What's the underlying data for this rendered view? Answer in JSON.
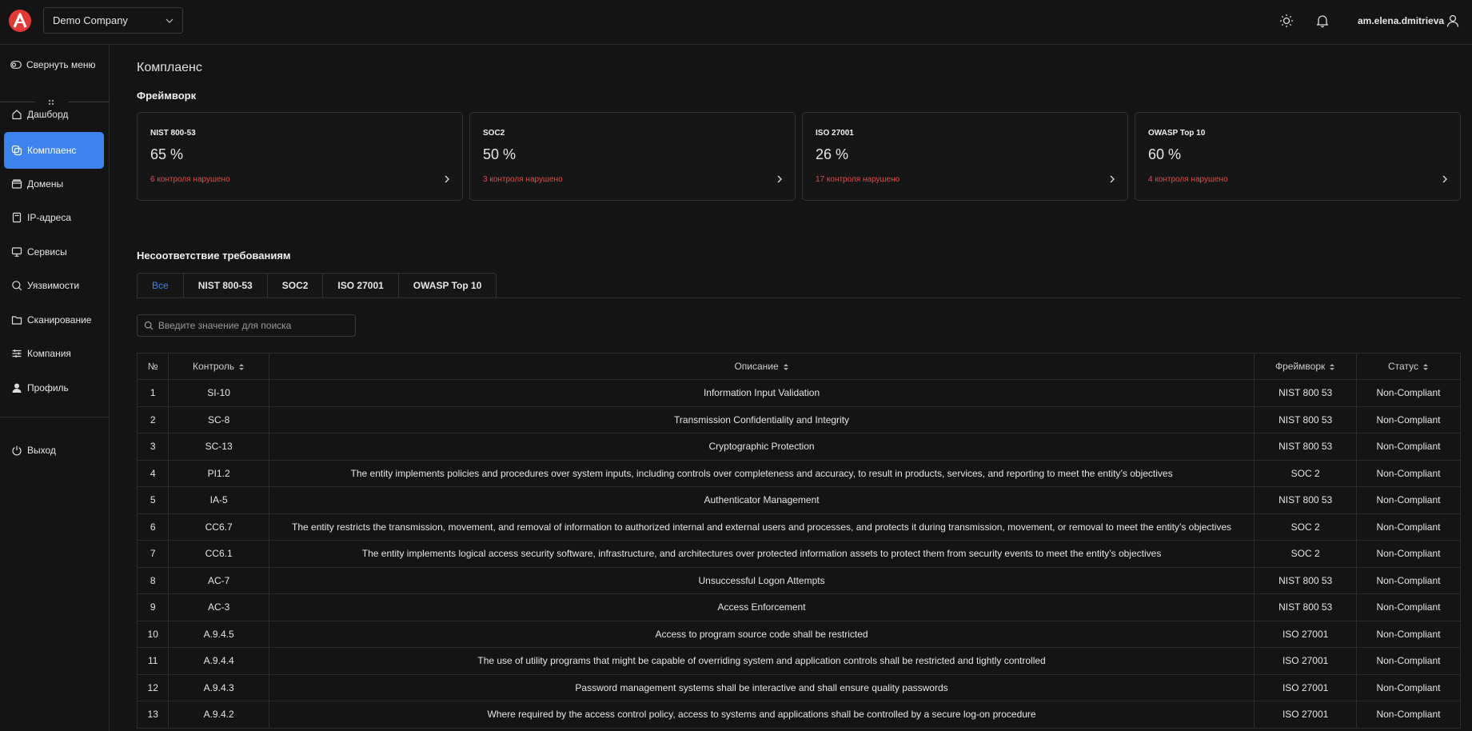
{
  "header": {
    "company": "Demo Company",
    "username": "am.elena.dmitrieva"
  },
  "sidebar": {
    "collapse_label": "Свернуть меню",
    "items": [
      {
        "label": "Дашборд",
        "icon": "home-icon"
      },
      {
        "label": "Комплаенс",
        "icon": "layers-icon",
        "active": true
      },
      {
        "label": "Домены",
        "icon": "folder-icon"
      },
      {
        "label": "IP-адреса",
        "icon": "document-icon"
      },
      {
        "label": "Сервисы",
        "icon": "monitor-icon"
      },
      {
        "label": "Уязвимости",
        "icon": "search-icon"
      },
      {
        "label": "Сканирование",
        "icon": "folder-outline-icon"
      },
      {
        "label": "Компания",
        "icon": "sliders-icon"
      },
      {
        "label": "Профиль",
        "icon": "user-icon"
      }
    ],
    "logout_label": "Выход"
  },
  "page": {
    "title": "Комплаенс",
    "frameworks_title": "Фреймворк",
    "noncompliance_title": "Несоответствие требованиям"
  },
  "cards": [
    {
      "name": "NIST 800-53",
      "percent": "65 %",
      "violations": "6 контроля нарушено"
    },
    {
      "name": "SOC2",
      "percent": "50 %",
      "violations": "3 контроля нарушено"
    },
    {
      "name": "ISO 27001",
      "percent": "26 %",
      "violations": "17 контроля нарушено"
    },
    {
      "name": "OWASP Top 10",
      "percent": "60 %",
      "violations": "4 контроля нарушено"
    }
  ],
  "tabs": [
    "Все",
    "NIST 800-53",
    "SOC2",
    "ISO 27001",
    "OWASP Top 10"
  ],
  "search": {
    "placeholder": "Введите значение для поиска"
  },
  "table": {
    "headers": [
      "№",
      "Контроль",
      "Описание",
      "Фреймворк",
      "Статус"
    ],
    "rows": [
      [
        "1",
        "SI-10",
        "Information Input Validation",
        "NIST 800 53",
        "Non-Compliant"
      ],
      [
        "2",
        "SC-8",
        "Transmission Confidentiality and Integrity",
        "NIST 800 53",
        "Non-Compliant"
      ],
      [
        "3",
        "SC-13",
        "Cryptographic Protection",
        "NIST 800 53",
        "Non-Compliant"
      ],
      [
        "4",
        "PI1.2",
        "The entity implements policies and procedures over system inputs, including controls over completeness and accuracy, to result in products, services, and reporting to meet the entity’s objectives",
        "SOC 2",
        "Non-Compliant"
      ],
      [
        "5",
        "IA-5",
        "Authenticator Management",
        "NIST 800 53",
        "Non-Compliant"
      ],
      [
        "6",
        "CC6.7",
        "The entity restricts the transmission, movement, and removal of information to authorized internal and external users and processes, and protects it during transmission, movement, or removal to meet the entity’s objectives",
        "SOC 2",
        "Non-Compliant"
      ],
      [
        "7",
        "CC6.1",
        "The entity implements logical access security software, infrastructure, and architectures over protected information assets to protect them from security events to meet the entity’s objectives",
        "SOC 2",
        "Non-Compliant"
      ],
      [
        "8",
        "AC-7",
        "Unsuccessful Logon Attempts",
        "NIST 800 53",
        "Non-Compliant"
      ],
      [
        "9",
        "AC-3",
        "Access Enforcement",
        "NIST 800 53",
        "Non-Compliant"
      ],
      [
        "10",
        "A.9.4.5",
        "Access to program source code shall be restricted",
        "ISO 27001",
        "Non-Compliant"
      ],
      [
        "11",
        "A.9.4.4",
        "The use of utility programs that might be capable of overriding system and application controls shall be restricted and tightly controlled",
        "ISO 27001",
        "Non-Compliant"
      ],
      [
        "12",
        "A.9.4.3",
        "Password management systems shall be interactive and shall ensure quality passwords",
        "ISO 27001",
        "Non-Compliant"
      ],
      [
        "13",
        "A.9.4.2",
        "Where required by the access control policy, access to systems and applications shall be controlled by a secure log-on procedure",
        "ISO 27001",
        "Non-Compliant"
      ]
    ]
  },
  "colors": {
    "accent": "#3d83f0",
    "danger": "#e84a4a",
    "background": "#141414"
  }
}
